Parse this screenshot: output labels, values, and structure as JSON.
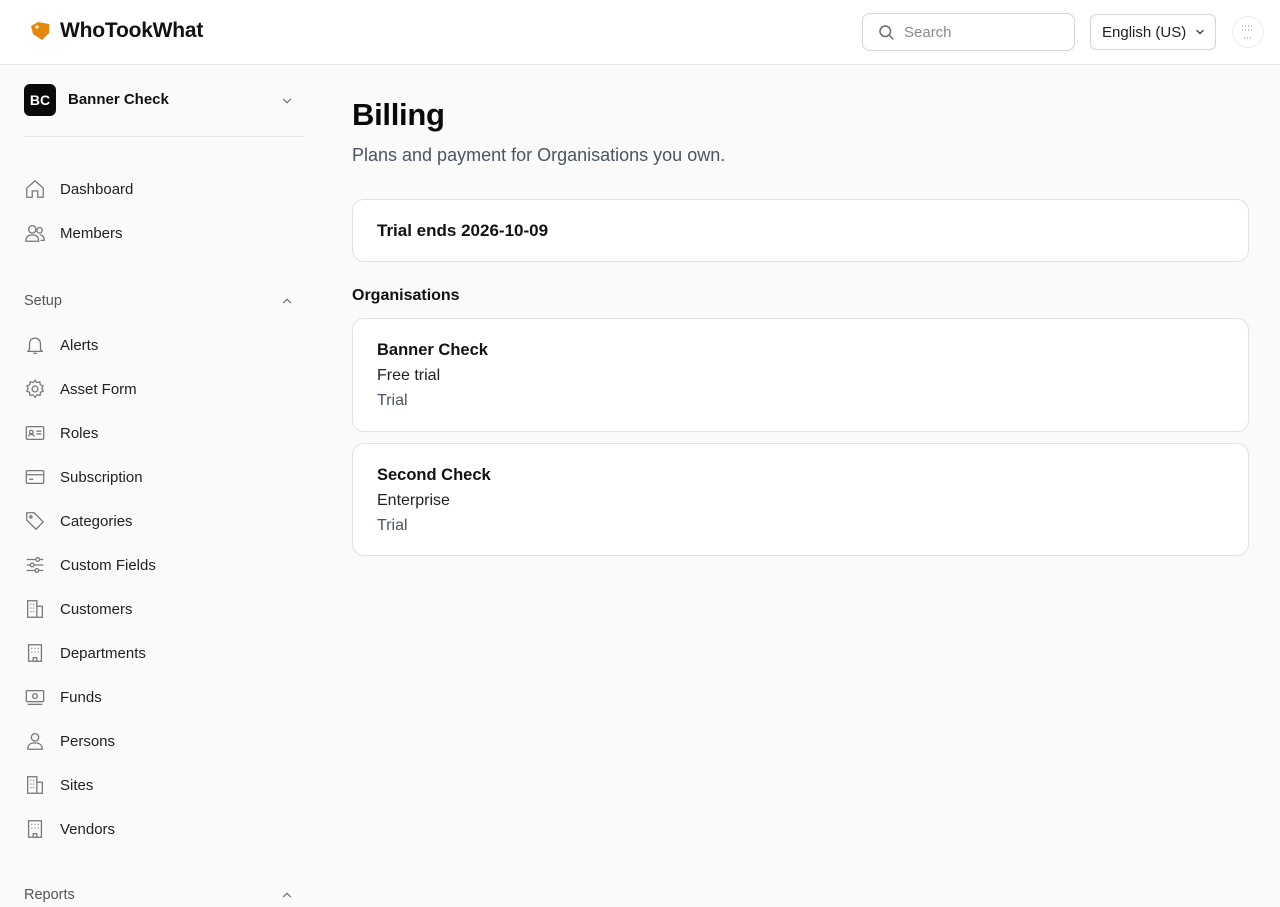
{
  "header": {
    "brand": "WhoTookWhat",
    "search": {
      "placeholder": "Search",
      "value": ""
    },
    "language": "English (US)"
  },
  "sidebar": {
    "org": {
      "initials": "BC",
      "name": "Banner Check"
    },
    "top_items": [
      {
        "label": "Dashboard",
        "icon": "home-icon"
      },
      {
        "label": "Members",
        "icon": "users-icon"
      }
    ],
    "setup": {
      "heading": "Setup",
      "items": [
        {
          "label": "Alerts",
          "icon": "bell-icon"
        },
        {
          "label": "Asset Form",
          "icon": "gear-icon"
        },
        {
          "label": "Roles",
          "icon": "id-card-icon"
        },
        {
          "label": "Subscription",
          "icon": "credit-card-icon"
        },
        {
          "label": "Categories",
          "icon": "tag-icon"
        },
        {
          "label": "Custom Fields",
          "icon": "sliders-icon"
        },
        {
          "label": "Customers",
          "icon": "building-icon"
        },
        {
          "label": "Departments",
          "icon": "building-icon"
        },
        {
          "label": "Funds",
          "icon": "banknote-icon"
        },
        {
          "label": "Persons",
          "icon": "user-icon"
        },
        {
          "label": "Sites",
          "icon": "building-icon"
        },
        {
          "label": "Vendors",
          "icon": "building-icon"
        }
      ]
    },
    "reports": {
      "heading": "Reports"
    }
  },
  "main": {
    "title": "Billing",
    "subtitle": "Plans and payment for Organisations you own.",
    "trial_notice": "Trial ends 2026-10-09",
    "orgs_heading": "Organisations",
    "organisations": [
      {
        "name": "Banner Check",
        "plan": "Free trial",
        "status": "Trial"
      },
      {
        "name": "Second Check",
        "plan": "Enterprise",
        "status": "Trial"
      }
    ]
  },
  "colors": {
    "brand_accent": "#e8850c",
    "org_badge": "#0a0a0a",
    "border": "#e2e2e2"
  }
}
